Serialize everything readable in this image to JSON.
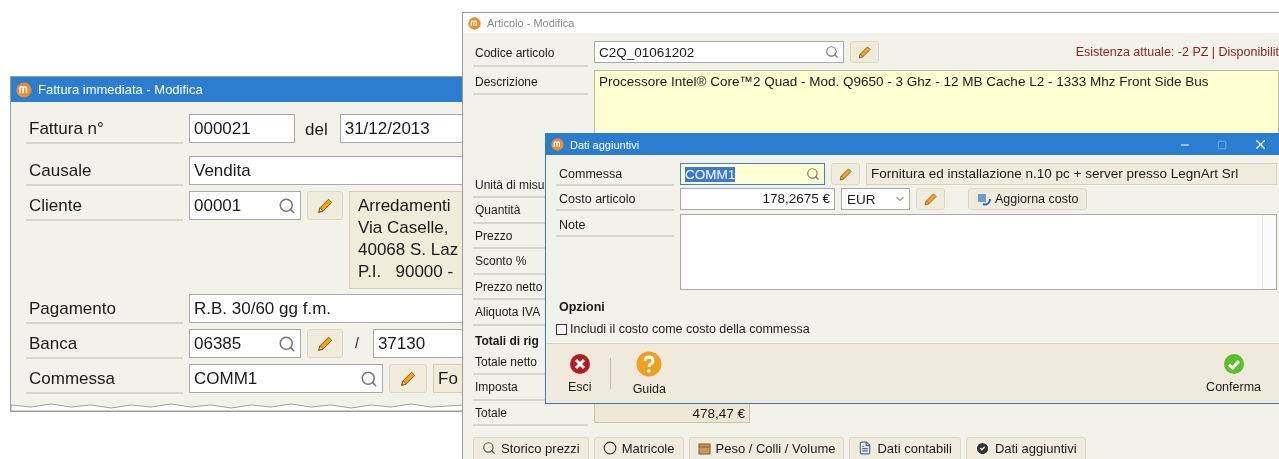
{
  "invoice_window": {
    "title": "Fattura immediata - Modifica",
    "number": {
      "label": "Fattura n°",
      "value": "000021",
      "date_label": "del",
      "date": "31/12/2013"
    },
    "reason": {
      "label": "Causale",
      "value": "Vendita"
    },
    "customer": {
      "label": "Cliente",
      "code": "00001",
      "address": [
        "Arredamenti",
        "Via Caselle,",
        "40068 S. Laz",
        "P.I.   90000 -"
      ]
    },
    "payment": {
      "label": "Pagamento",
      "value": "R.B. 30/60 gg f.m."
    },
    "bank": {
      "label": "Banca",
      "code": "06385",
      "separator": "/",
      "code_2": "37130"
    },
    "job": {
      "label": "Commessa",
      "code": "COMM1",
      "description": "Fo"
    }
  },
  "article_window": {
    "title": "Articolo - Modifica",
    "code": {
      "label": "Codice articolo",
      "value": "C2Q_01061202",
      "stock": "Esistenza attuale: -2 PZ | Disponibilit"
    },
    "description": {
      "label": "Descrizione",
      "value": "Processore Intel® Core™2 Quad - Mod. Q9650 - 3 Ghz - 12 MB Cache L2 - 1333 Mhz Front Side Bus"
    },
    "fields": [
      {
        "kind": "label",
        "label": "Unità di misu"
      },
      {
        "kind": "label",
        "label": "Quantità"
      },
      {
        "kind": "label",
        "label": "Prezzo"
      },
      {
        "kind": "label",
        "label": "Sconto %"
      },
      {
        "kind": "label",
        "label": "Prezzo netto"
      },
      {
        "kind": "label",
        "label": "Aliquota IVA"
      },
      {
        "kind": "heading",
        "label": "Totali di rig"
      },
      {
        "kind": "label",
        "label": "Totale netto"
      },
      {
        "kind": "label",
        "label": "Imposta"
      },
      {
        "kind": "total",
        "label": "Totale",
        "value": "478,47 €"
      }
    ],
    "tabs": [
      "Storico prezzi",
      "Matricole",
      "Peso / Colli / Volume",
      "Dati contabili",
      "Dati aggiuntivi"
    ]
  },
  "extra_data_dialog": {
    "title": "Dati aggiuntivi",
    "job": {
      "label": "Commessa",
      "code": "COMM1",
      "code_selected": true,
      "description": "Fornitura ed installazione n.10 pc + server presso LegnArt Srl"
    },
    "cost": {
      "label": "Costo articolo",
      "value": "178,2675 €",
      "currency": "EUR",
      "button": "Aggiorna costo"
    },
    "notes": {
      "label": "Note"
    },
    "options": {
      "heading": "Opzioni",
      "include_cost": {
        "label": "Includi il costo come costo della commessa",
        "checked": false
      }
    },
    "actions": [
      {
        "kind": "cancel",
        "label": "Esci"
      },
      {
        "kind": "help",
        "label": "Guida"
      },
      {
        "kind": "confirm",
        "label": "Conferma"
      }
    ]
  }
}
